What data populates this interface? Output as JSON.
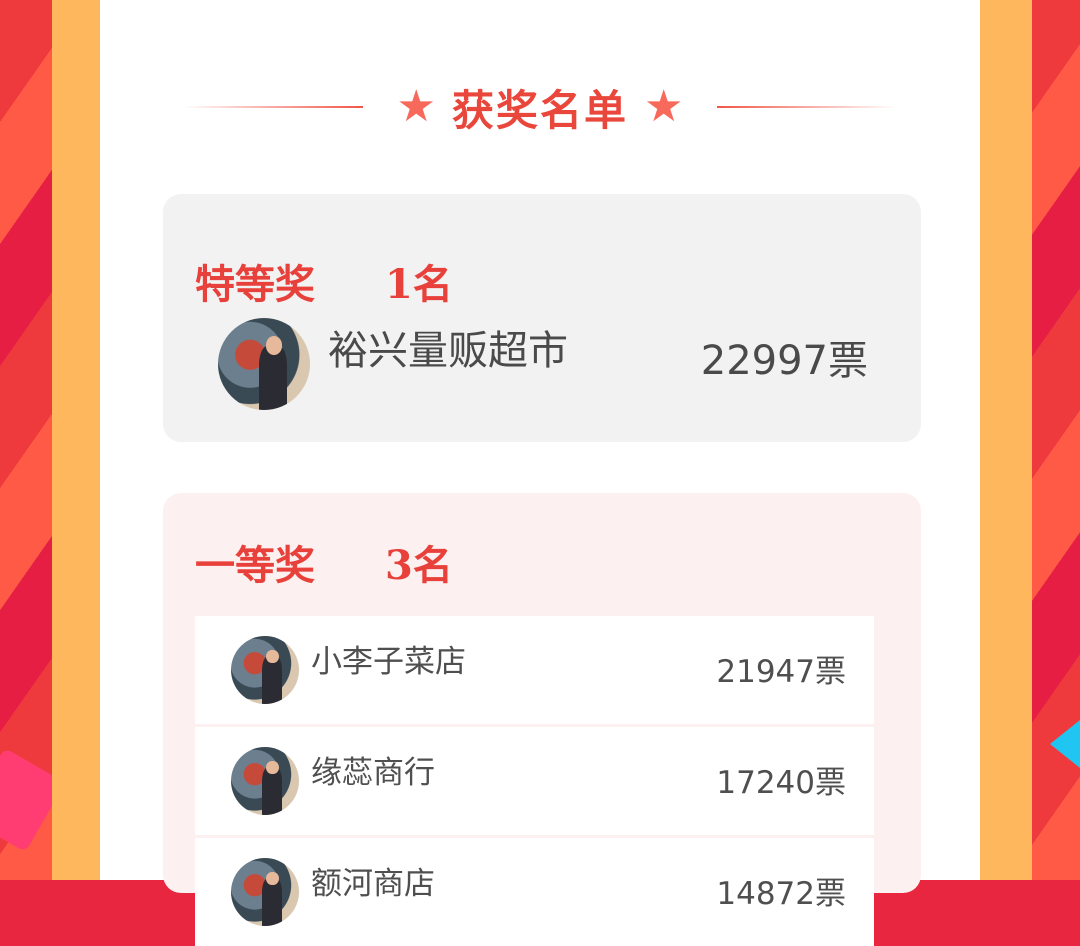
{
  "heading": {
    "title": "获奖名单"
  },
  "special_prize": {
    "title": "特等奖",
    "count": "1名",
    "winners": [
      {
        "name": "裕兴量贩超市",
        "votes": "22997票"
      }
    ]
  },
  "first_prize": {
    "title": "一等奖",
    "count": "3名",
    "winners": [
      {
        "name": "小李子菜店",
        "votes": "21947票"
      },
      {
        "name": "缘蕊商行",
        "votes": "17240票"
      },
      {
        "name": "额河商店",
        "votes": "14872票"
      }
    ]
  },
  "colors": {
    "accent_red": "#e8403a",
    "frame_orange": "#ffb75e",
    "panel_white": "#ffffff",
    "special_card_bg": "#f2f2f2",
    "first_card_bg": "#fcf1f0"
  },
  "icons": {
    "heading_left": "star-icon",
    "heading_right": "star-icon"
  }
}
